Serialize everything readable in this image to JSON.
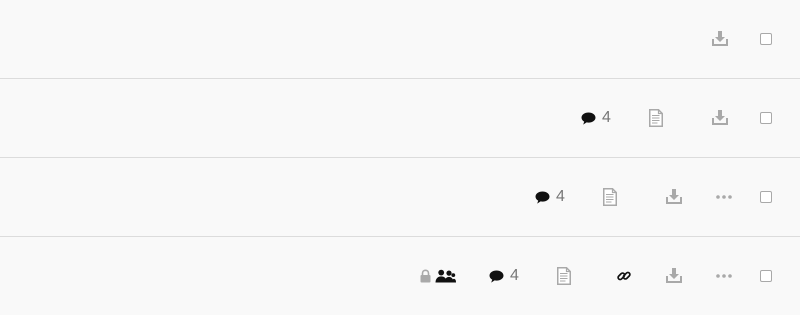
{
  "colors": {
    "background": "#f9f9f9",
    "divider": "#dcdcdc",
    "icon_muted": "#a9a9a9",
    "icon_dark": "#111111",
    "count_text": "#777777"
  },
  "rows": [
    {
      "actions": [
        "download-icon",
        "select-checkbox"
      ]
    },
    {
      "comment_count": "4",
      "actions": [
        "comment-icon",
        "document-icon",
        "download-icon",
        "select-checkbox"
      ]
    },
    {
      "comment_count": "4",
      "actions": [
        "comment-icon",
        "document-icon",
        "download-icon",
        "more-icon",
        "select-checkbox"
      ]
    },
    {
      "comment_count": "4",
      "actions": [
        "lock-icon",
        "shared-users-icon",
        "comment-icon",
        "document-icon",
        "link-icon",
        "download-icon",
        "more-icon",
        "select-checkbox"
      ]
    }
  ]
}
